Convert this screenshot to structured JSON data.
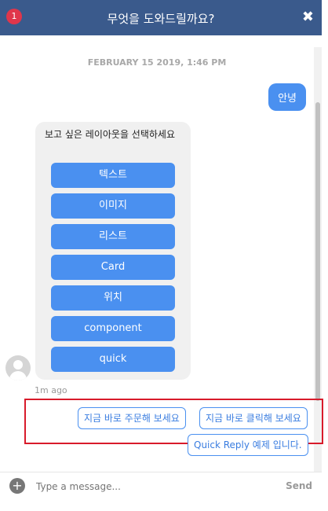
{
  "header": {
    "badge": "1",
    "title": "무엇을 도와드릴까요?",
    "close_glyph": "✖"
  },
  "chat": {
    "timestamp": "FEBRUARY 15 2019, 1:46 PM",
    "user_message": "안녕",
    "bot_prompt": "보고 싶은 레이아웃을 선택하세요",
    "choices": [
      "텍스트",
      "이미지",
      "리스트",
      "Card",
      "위치",
      "component",
      "quick"
    ],
    "time_ago": "1m ago",
    "quick_replies": [
      "지금 바로 주문해 보세요",
      "지금 바로 클릭해 보세요",
      "Quick Reply 예제 입니다."
    ]
  },
  "input": {
    "placeholder": "Type a message...",
    "send_label": "Send",
    "plus_glyph": "+"
  },
  "colors": {
    "header": "#3a5a8c",
    "accent": "#4a90f0",
    "highlight": "#d81b2b"
  }
}
